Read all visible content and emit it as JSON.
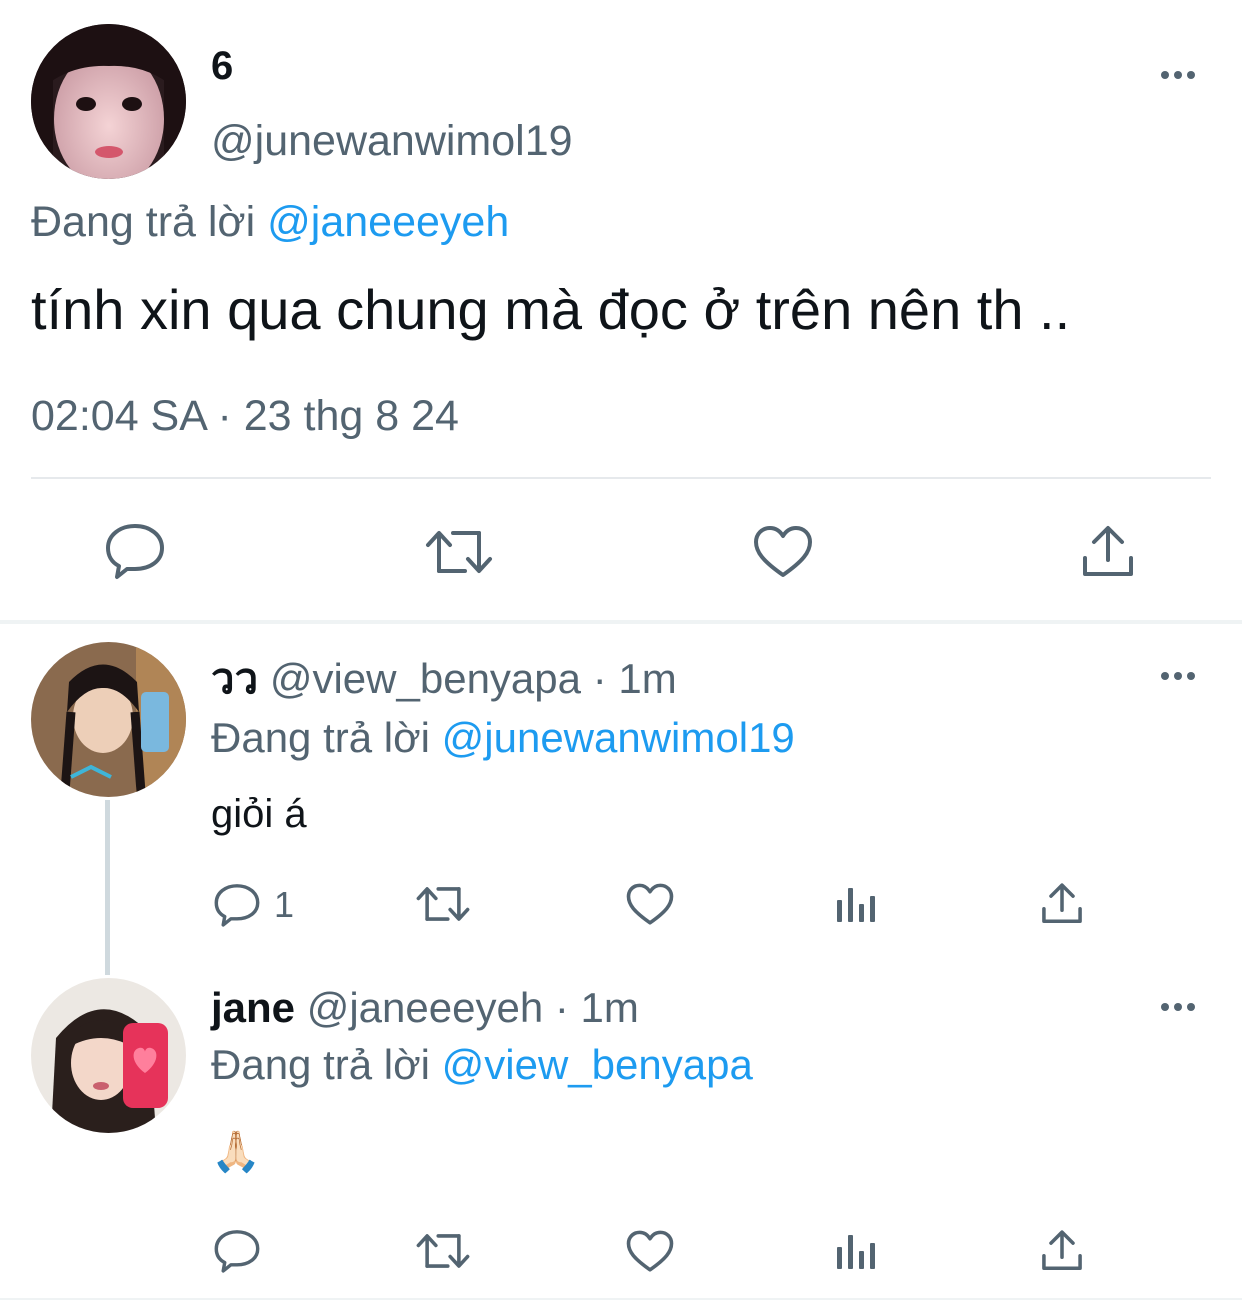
{
  "main_tweet": {
    "display_name": "6",
    "handle": "@junewanwimol19",
    "reply_prefix": "Đang trả lời",
    "reply_to": "@janeeeyeh",
    "text": "tính xin qua chung mà đọc ở trên nên th ..",
    "timestamp": "02:04 SA · 23 thg 8 24",
    "actions": [
      "reply-icon",
      "retweet-icon",
      "like-icon",
      "share-icon"
    ]
  },
  "replies": [
    {
      "display_name": "วว",
      "handle": "@view_benyapa",
      "separator": "·",
      "time": "1m",
      "reply_prefix": "Đang trả lời",
      "reply_to": "@junewanwimol19",
      "text": "giỏi á",
      "reply_count": "1",
      "actions": [
        "reply-icon",
        "retweet-icon",
        "like-icon",
        "views-icon",
        "share-icon"
      ]
    },
    {
      "display_name": "jane",
      "handle": "@janeeeyeh",
      "separator": "·",
      "time": "1m",
      "reply_prefix": "Đang trả lời",
      "reply_to": "@view_benyapa",
      "text": "🙏🏻",
      "reply_count": "",
      "actions": [
        "reply-icon",
        "retweet-icon",
        "like-icon",
        "views-icon",
        "share-icon"
      ]
    }
  ],
  "colors": {
    "text": "#0f1419",
    "muted": "#536471",
    "link": "#1d9bf0",
    "divider": "#e6e9ec"
  }
}
